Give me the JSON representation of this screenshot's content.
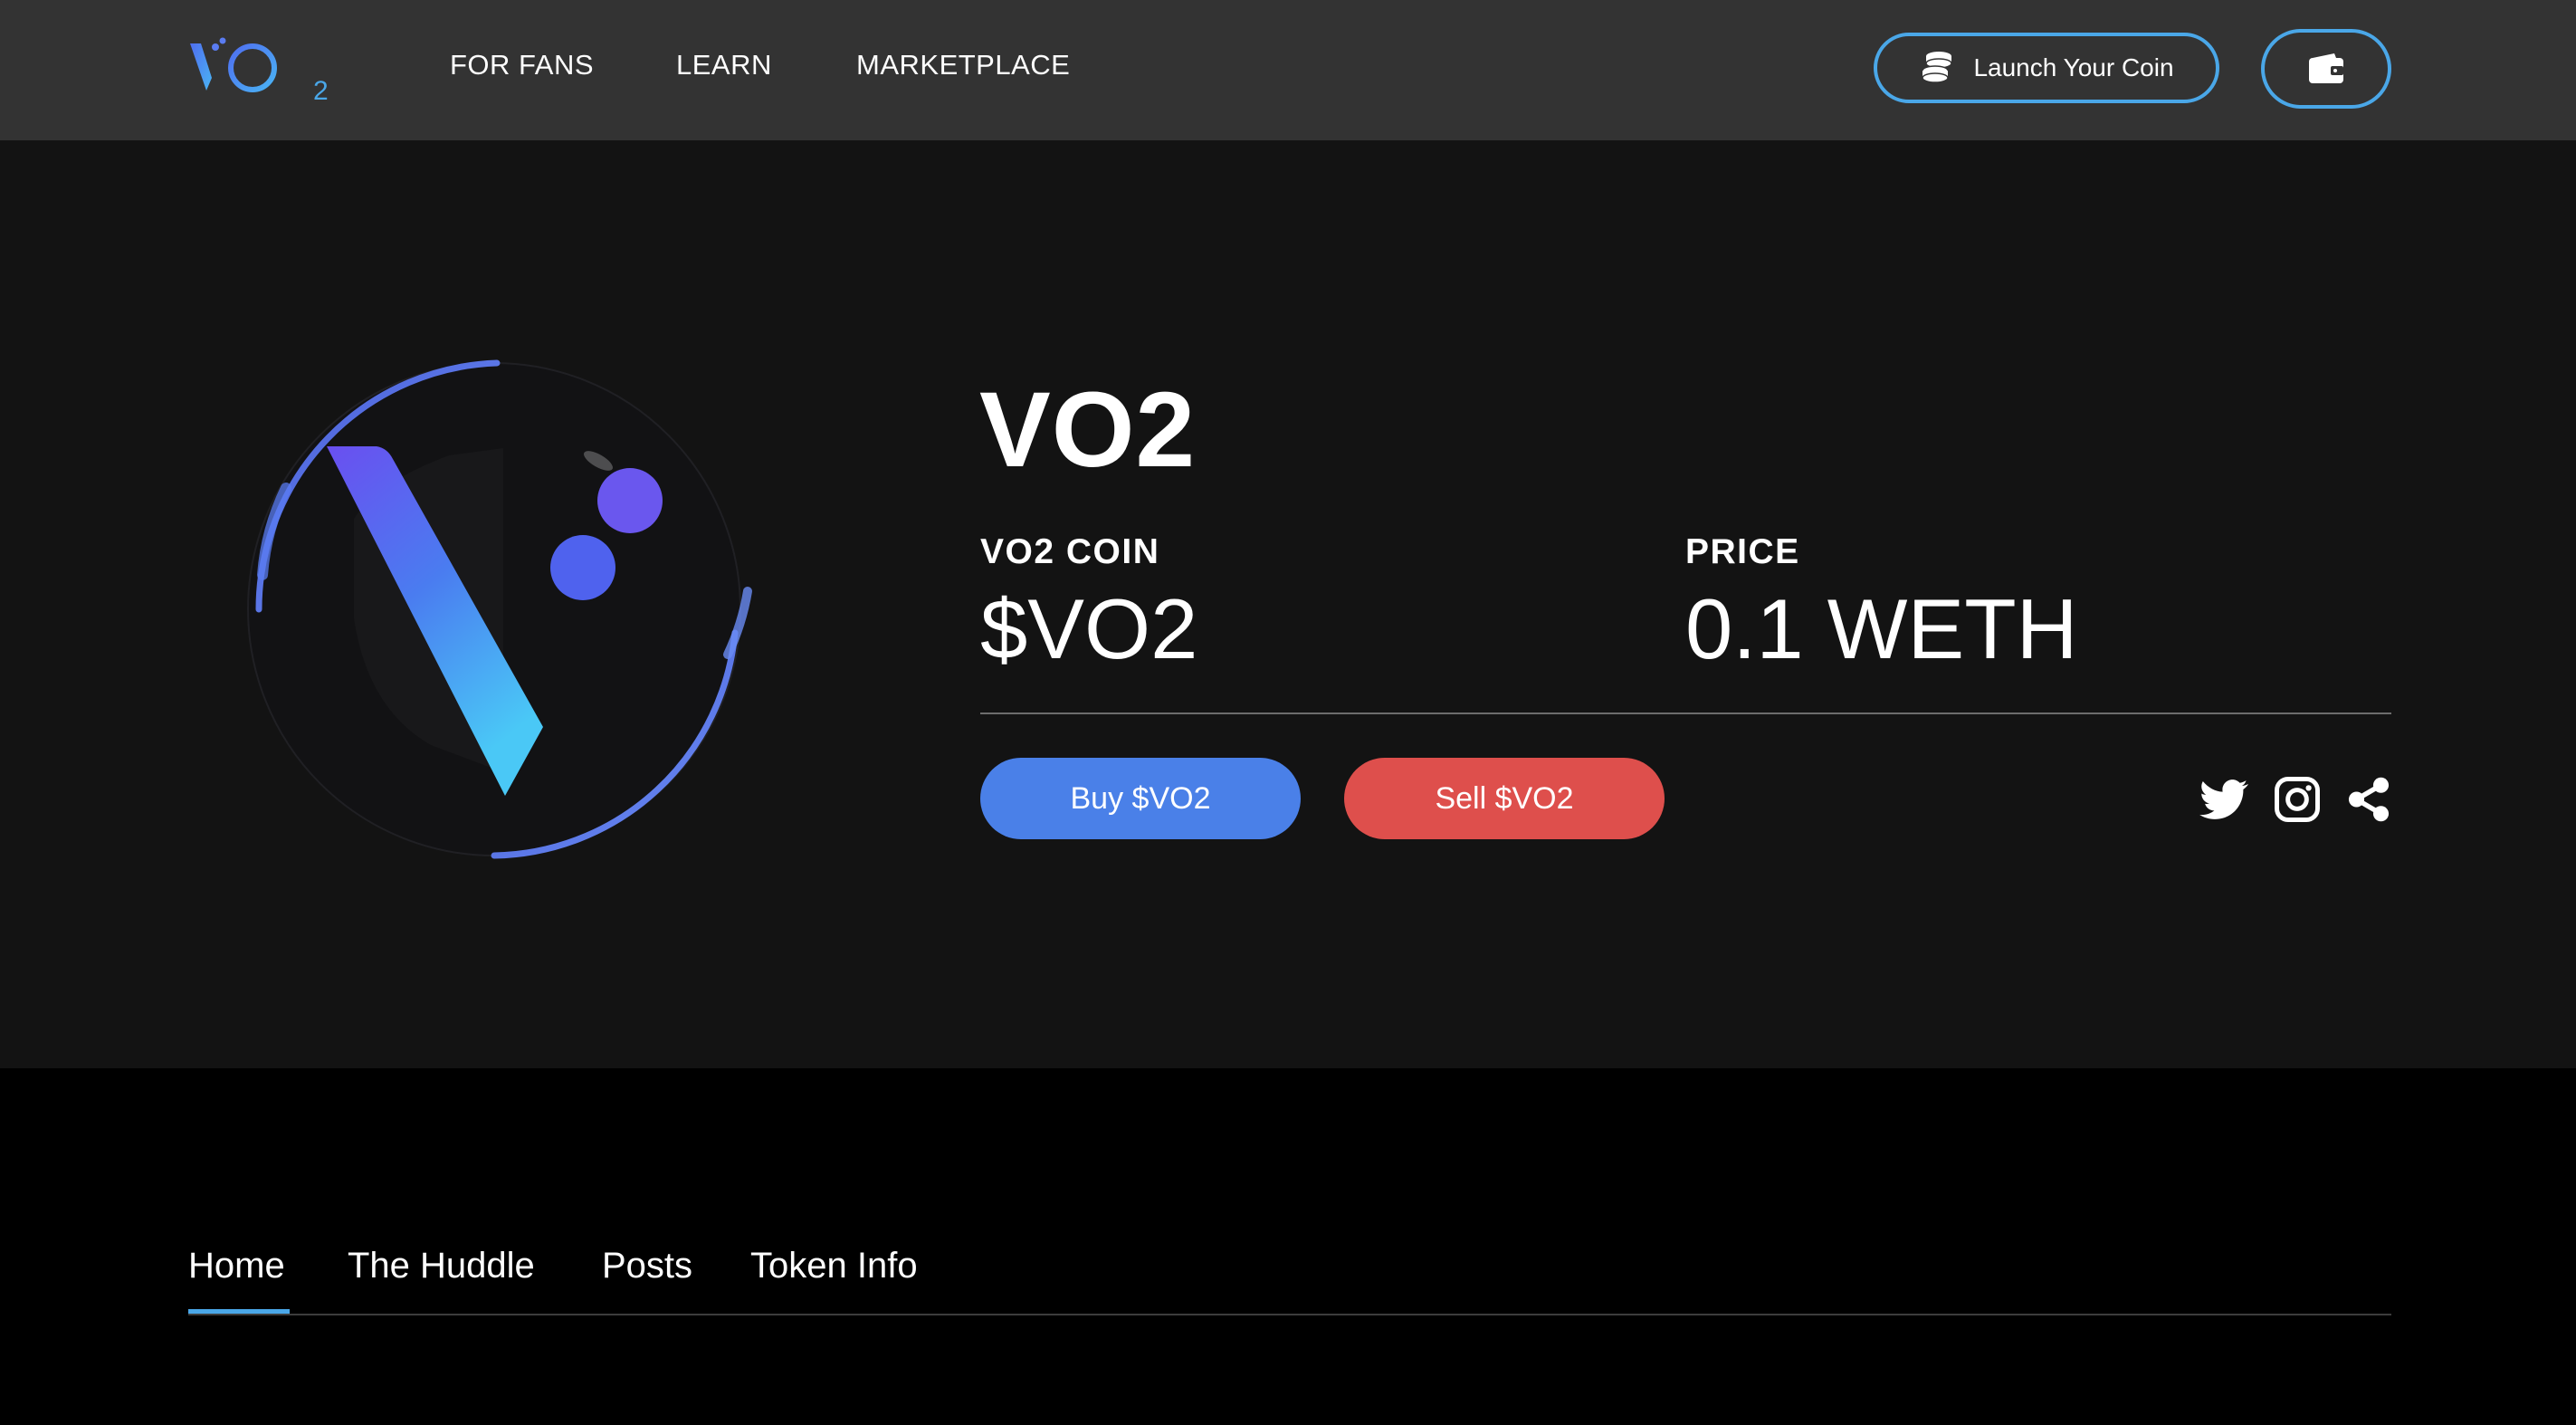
{
  "header": {
    "logo_alt": "VO2",
    "nav": [
      {
        "label": "FOR FANS"
      },
      {
        "label": "LEARN"
      },
      {
        "label": "MARKETPLACE"
      }
    ],
    "launch_label": "Launch Your Coin",
    "launch_icon": "coins-icon",
    "wallet_icon": "wallet-icon"
  },
  "coin": {
    "name": "VO2",
    "symbol_label": "VO2 COIN",
    "symbol": "$VO2",
    "price_label": "PRICE",
    "price": "0.1 WETH",
    "buy_label": "Buy $VO2",
    "sell_label": "Sell $VO2"
  },
  "social": [
    "twitter-icon",
    "instagram-icon",
    "share-icon"
  ],
  "tabs": [
    {
      "label": "Home",
      "active": true
    },
    {
      "label": "The Huddle"
    },
    {
      "label": "Posts"
    },
    {
      "label": "Token Info"
    }
  ],
  "colors": {
    "accent": "#4aa7e8",
    "buy": "#4a80e8",
    "sell": "#de4f4c",
    "header_bg": "#333333",
    "hero_bg": "#131313",
    "page_bg": "#000000"
  }
}
